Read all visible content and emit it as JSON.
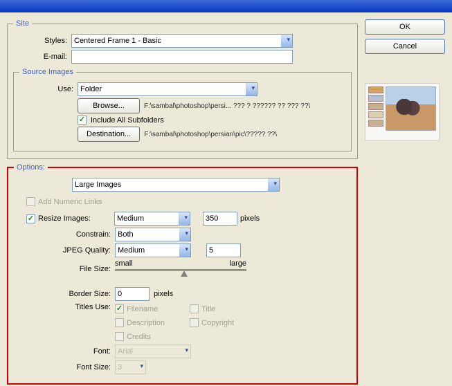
{
  "buttons": {
    "ok": "OK",
    "cancel": "Cancel",
    "browse": "Browse...",
    "destination": "Destination..."
  },
  "site": {
    "legend": "Site",
    "styles_label": "Styles:",
    "styles_value": "Centered Frame 1 - Basic",
    "email_label": "E-mail:",
    "email_value": ""
  },
  "source": {
    "legend": "Source Images",
    "use_label": "Use:",
    "use_value": "Folder",
    "browse_path": "F:\\sambal\\photoshop\\persi... ??? ? ?????? ?? ??? ??\\",
    "include_sub": "Include All Subfolders",
    "dest_path": "F:\\sambal\\photoshop\\persian\\pic\\????? ??\\"
  },
  "options": {
    "legend": "Options:",
    "section_value": "Large Images",
    "add_numeric": "Add Numeric Links",
    "resize_label": "Resize Images:",
    "resize_value": "Medium",
    "resize_px": "350",
    "pixels": "pixels",
    "constrain_label": "Constrain:",
    "constrain_value": "Both",
    "jpeg_label": "JPEG Quality:",
    "jpeg_value": "Medium",
    "jpeg_num": "5",
    "filesize_label": "File Size:",
    "small": "small",
    "large": "large",
    "border_label": "Border Size:",
    "border_value": "0",
    "titles_label": "Titles Use:",
    "t_filename": "Filename",
    "t_description": "Description",
    "t_credits": "Credits",
    "t_title": "Title",
    "t_copyright": "Copyright",
    "font_label": "Font:",
    "font_value": "Arial",
    "fontsize_label": "Font Size:",
    "fontsize_value": "3"
  }
}
